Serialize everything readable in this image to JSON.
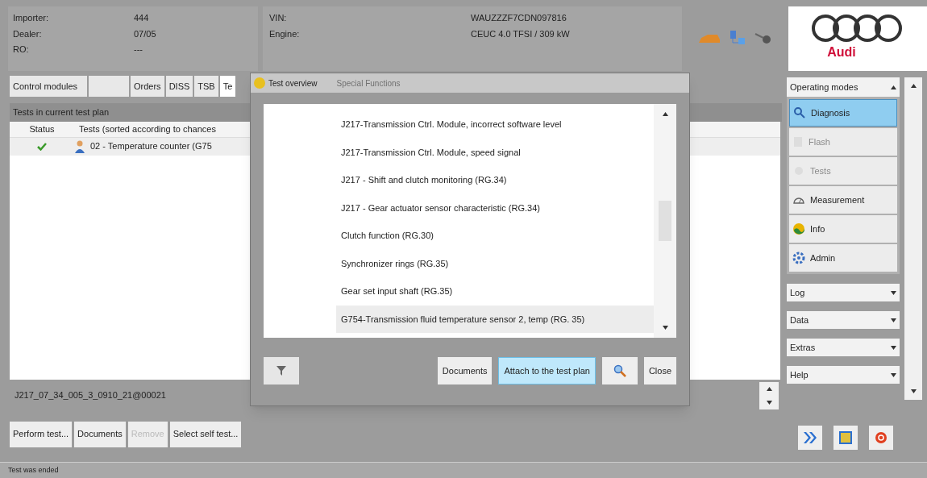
{
  "header": {
    "dealer_fields": [
      {
        "label": "Importer:",
        "value": "444"
      },
      {
        "label": "Dealer:",
        "value": "07/05"
      },
      {
        "label": "RO:",
        "value": "---"
      }
    ],
    "vehicle_fields": [
      {
        "label": "VIN:",
        "value": "WAUZZZF7CDN097816"
      },
      {
        "label": "Engine:",
        "value": "CEUC 4.0 TFSI / 309 kW"
      }
    ],
    "brand": "Audi"
  },
  "tabs": [
    {
      "label": "Control modules",
      "selected": false
    },
    {
      "selected": false
    },
    {
      "label": "Orders",
      "selected": false
    },
    {
      "label": "DISS",
      "selected": false
    },
    {
      "label": "TSB",
      "selected": false
    },
    {
      "label": "Te",
      "selected": true
    }
  ],
  "test_plan": {
    "title": "Tests in current test plan",
    "columns": [
      "Status",
      "Tests (sorted according to chances"
    ],
    "rows": [
      {
        "done": true,
        "test": "02 - Temperature counter (G75"
      }
    ],
    "code": "J217_07_34_005_3_0910_21@00021"
  },
  "buttons": [
    {
      "label": "Perform test...",
      "disabled": false
    },
    {
      "label": "Documents",
      "disabled": false
    },
    {
      "label": "Remove",
      "disabled": true
    },
    {
      "label": "Select self test...",
      "disabled": false
    }
  ],
  "status_bar": "Test was ended",
  "dialog": {
    "title": "Test overview",
    "subtitle": "Special Functions",
    "items": [
      {
        "label": "J217-Transmission Ctrl. Module, incorrect software level",
        "selected": false
      },
      {
        "label": "J217-Transmission Ctrl. Module, speed signal",
        "selected": false
      },
      {
        "label": "J217 - Shift and clutch monitoring (RG.34)",
        "selected": false
      },
      {
        "label": "J217 - Gear actuator sensor characteristic (RG.34)",
        "selected": false
      },
      {
        "label": "Clutch function (RG.30)",
        "selected": false
      },
      {
        "label": "Synchronizer rings (RG.35)",
        "selected": false
      },
      {
        "label": "Gear set input shaft (RG.35)",
        "selected": false
      },
      {
        "label": "G754-Transmission fluid temperature sensor 2, temp (RG. 35)",
        "selected": true
      }
    ],
    "buttons": [
      {
        "label": "Documents",
        "kind": "text",
        "highlighted": false
      },
      {
        "label": "Attach to the test plan",
        "kind": "text",
        "highlighted": true
      },
      {
        "kind": "search",
        "highlighted": false
      },
      {
        "label": "Close",
        "kind": "text",
        "highlighted": false
      }
    ]
  },
  "sidebar": {
    "title": "Operating modes",
    "modes": [
      {
        "label": "Diagnosis",
        "selected": true,
        "disabled": false
      },
      {
        "label": "Flash",
        "selected": false,
        "disabled": true
      },
      {
        "label": "Tests",
        "selected": false,
        "disabled": true
      },
      {
        "label": "Measurement",
        "selected": false,
        "disabled": false
      },
      {
        "label": "Info",
        "selected": false,
        "disabled": false
      },
      {
        "label": "Admin",
        "selected": false,
        "disabled": false
      }
    ],
    "menus": [
      "Log",
      "Data",
      "Extras",
      "Help"
    ]
  }
}
